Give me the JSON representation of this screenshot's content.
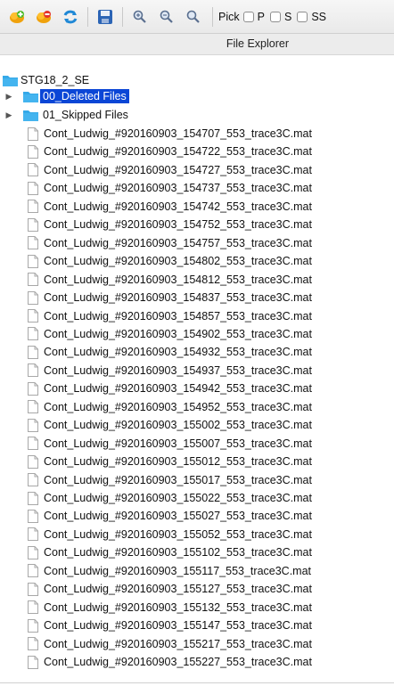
{
  "toolbar": {
    "buttons": [
      {
        "name": "add-green-icon"
      },
      {
        "name": "remove-red-icon"
      },
      {
        "name": "refresh-icon"
      },
      {
        "name": "save-icon"
      },
      {
        "name": "zoom-in-icon"
      },
      {
        "name": "zoom-out-icon"
      },
      {
        "name": "zoom-reset-icon"
      }
    ],
    "pick_label": "Pick",
    "checkboxes": [
      {
        "label": "P",
        "checked": false
      },
      {
        "label": "S",
        "checked": false
      },
      {
        "label": "SS",
        "checked": false
      }
    ]
  },
  "panel": {
    "title": "File Explorer"
  },
  "tree": {
    "root": {
      "label": "STG18_2_SE"
    },
    "folders": [
      {
        "label": "00_Deleted Files",
        "selected": true
      },
      {
        "label": "01_Skipped Files",
        "selected": false
      }
    ],
    "files": [
      "Cont_Ludwig_#920160903_154707_553_trace3C.mat",
      "Cont_Ludwig_#920160903_154722_553_trace3C.mat",
      "Cont_Ludwig_#920160903_154727_553_trace3C.mat",
      "Cont_Ludwig_#920160903_154737_553_trace3C.mat",
      "Cont_Ludwig_#920160903_154742_553_trace3C.mat",
      "Cont_Ludwig_#920160903_154752_553_trace3C.mat",
      "Cont_Ludwig_#920160903_154757_553_trace3C.mat",
      "Cont_Ludwig_#920160903_154802_553_trace3C.mat",
      "Cont_Ludwig_#920160903_154812_553_trace3C.mat",
      "Cont_Ludwig_#920160903_154837_553_trace3C.mat",
      "Cont_Ludwig_#920160903_154857_553_trace3C.mat",
      "Cont_Ludwig_#920160903_154902_553_trace3C.mat",
      "Cont_Ludwig_#920160903_154932_553_trace3C.mat",
      "Cont_Ludwig_#920160903_154937_553_trace3C.mat",
      "Cont_Ludwig_#920160903_154942_553_trace3C.mat",
      "Cont_Ludwig_#920160903_154952_553_trace3C.mat",
      "Cont_Ludwig_#920160903_155002_553_trace3C.mat",
      "Cont_Ludwig_#920160903_155007_553_trace3C.mat",
      "Cont_Ludwig_#920160903_155012_553_trace3C.mat",
      "Cont_Ludwig_#920160903_155017_553_trace3C.mat",
      "Cont_Ludwig_#920160903_155022_553_trace3C.mat",
      "Cont_Ludwig_#920160903_155027_553_trace3C.mat",
      "Cont_Ludwig_#920160903_155052_553_trace3C.mat",
      "Cont_Ludwig_#920160903_155102_553_trace3C.mat",
      "Cont_Ludwig_#920160903_155117_553_trace3C.mat",
      "Cont_Ludwig_#920160903_155127_553_trace3C.mat",
      "Cont_Ludwig_#920160903_155132_553_trace3C.mat",
      "Cont_Ludwig_#920160903_155147_553_trace3C.mat",
      "Cont_Ludwig_#920160903_155217_553_trace3C.mat",
      "Cont_Ludwig_#920160903_155227_553_trace3C.mat"
    ]
  },
  "colors": {
    "selection": "#0b46d6",
    "folder": "#35a9e8"
  }
}
